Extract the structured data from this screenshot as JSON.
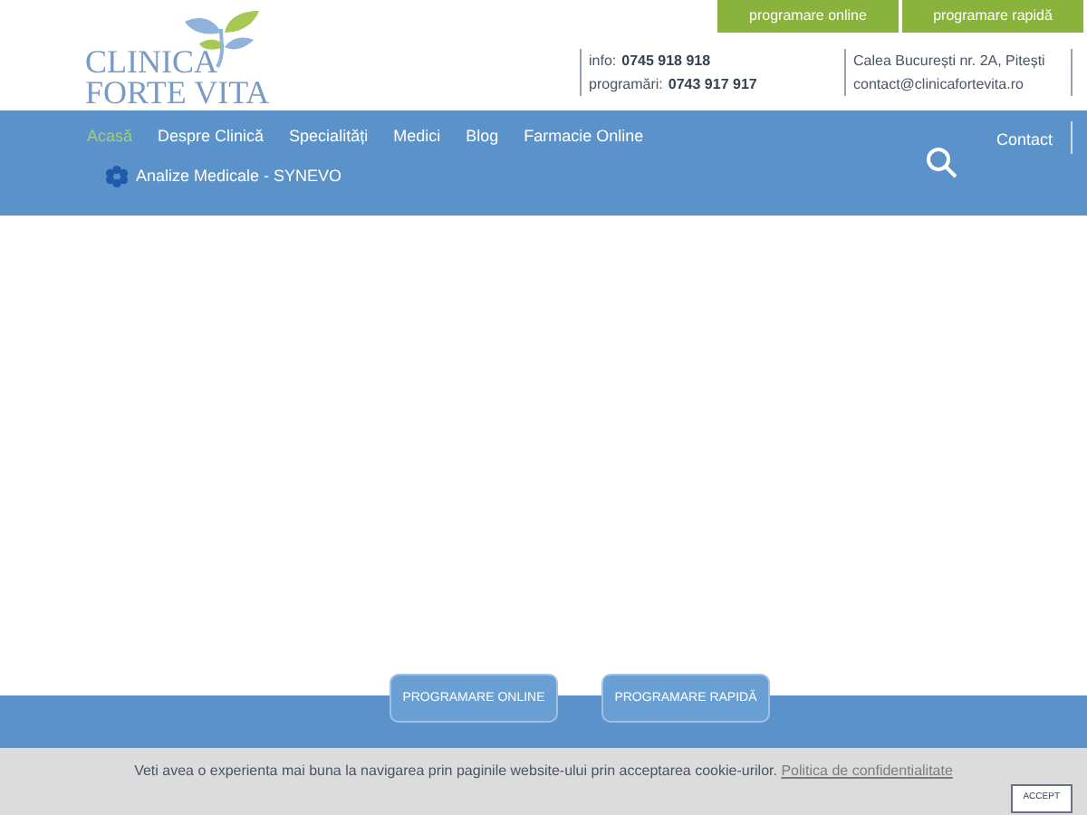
{
  "top_buttons": [
    "programare online",
    "programare rapidă"
  ],
  "logo": {
    "line_1": "CLINICA",
    "line_2": "FORTE VITA"
  },
  "contact_info": [
    {
      "label": "info:",
      "value": "0745 918 918"
    },
    {
      "label": "programări:",
      "value": "0743 917 917"
    }
  ],
  "address": [
    "Calea București nr. 2A, Pitești",
    "contact@clinicafortevita.ro"
  ],
  "nav": {
    "items": [
      {
        "label": "Acasă",
        "selected": true
      },
      {
        "label": "Despre Clinică",
        "selected": false
      },
      {
        "label": "Specialități",
        "selected": false
      },
      {
        "label": "Medici",
        "selected": false
      },
      {
        "label": "Blog",
        "selected": false
      },
      {
        "label": "Farmacie Online",
        "selected": false
      }
    ],
    "contact": "Contact",
    "sub_item": "Analize Medicale - SYNEVO"
  },
  "hero_buttons": [
    "PROGRAMARE ONLINE",
    "PROGRAMARE RAPIDĂ"
  ],
  "cookie_bar": {
    "message": "Veti avea o experienta mai buna la navigarea prin paginile website-ului prin acceptarea cookie-urilor.",
    "link": "Politica de confidentialitate",
    "button": "ACCEPT"
  }
}
